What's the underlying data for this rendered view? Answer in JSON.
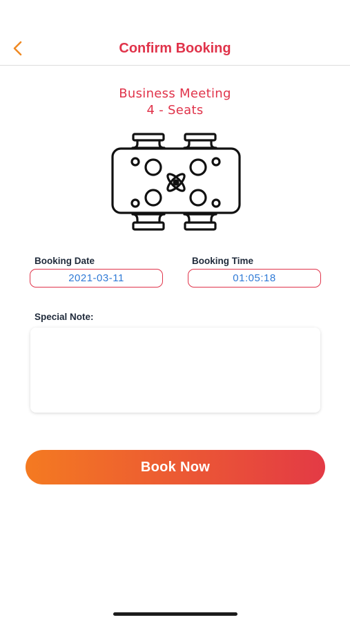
{
  "header": {
    "title": "Confirm Booking",
    "back_icon": "chevron-left-icon",
    "accent_color": "#e0334a",
    "back_color": "#f08a24"
  },
  "table": {
    "name": "Business Meeting",
    "seats": "4 - Seats",
    "icon": "dining-table-icon"
  },
  "booking": {
    "date_label": "Booking Date",
    "date_value": "2021-03-11",
    "time_label": "Booking Time",
    "time_value": "01:05:18",
    "note_label": "Special Note:",
    "note_value": ""
  },
  "actions": {
    "book_label": "Book Now",
    "gradient_start": "#f47a21",
    "gradient_end": "#e33a45"
  }
}
